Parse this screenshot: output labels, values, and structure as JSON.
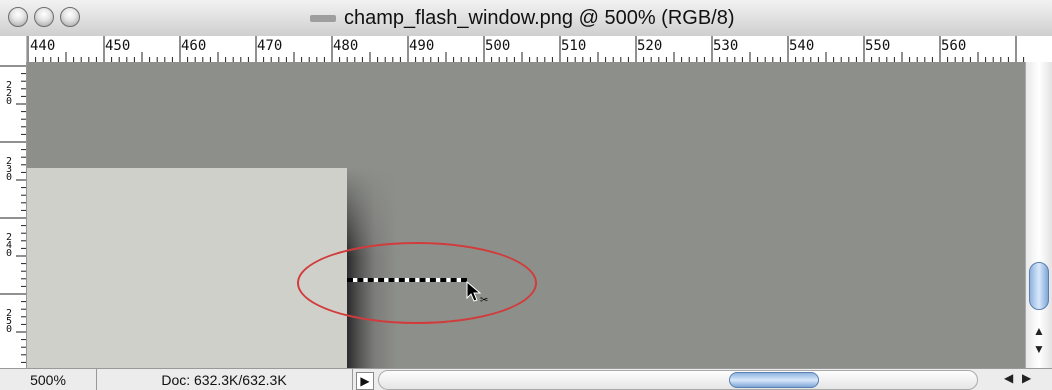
{
  "window": {
    "title": "champ_flash_window.png @ 500% (RGB/8)"
  },
  "ruler_h": {
    "labels": [
      "440",
      "450",
      "460",
      "470",
      "480",
      "490",
      "500",
      "510",
      "520",
      "530",
      "540",
      "550",
      "560"
    ]
  },
  "ruler_v": {
    "labels": [
      "2 2 0",
      "2 3 0",
      "2 4 0",
      "2 5 0"
    ]
  },
  "status": {
    "zoom": "500%",
    "doc": "Doc: 632.3K/632.3K"
  },
  "icons": {
    "close": "close-button-icon",
    "minimize": "minimize-button-icon",
    "zoom": "zoom-button-icon",
    "cursor": "marquee-cursor-icon"
  },
  "colors": {
    "canvas_gray": "#8d8f8a",
    "light_block": "#cfd0c9",
    "callout": "#d23b3b",
    "scroll_thumb": "#8fb4e0"
  }
}
